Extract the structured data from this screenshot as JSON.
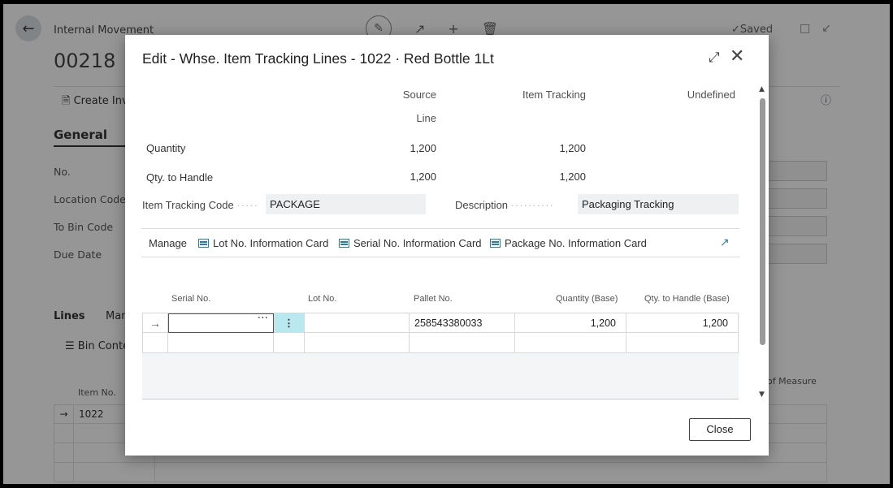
{
  "background": {
    "caption": "Internal Movement",
    "record_no": "00218",
    "saved_label": "Saved",
    "action_create": "Create Inve",
    "section_general": "General",
    "fields": [
      "No.",
      "Location Code",
      "To Bin Code",
      "Due Date"
    ],
    "lines_tab": "Lines",
    "lines_manage": "Man",
    "bin_content": "Bin Conten",
    "col_item_no": "Item No.",
    "col_unit_measure": "of Measure",
    "row_item": "1022"
  },
  "dialog": {
    "title": "Edit - Whse. Item Tracking Lines - 1022 · Red Bottle 1Lt",
    "summary": {
      "headers": [
        "Source",
        "Line",
        "Item Tracking",
        "Undefined"
      ],
      "rows": [
        {
          "label": "Quantity",
          "source": "1,200",
          "tracking": "1,200"
        },
        {
          "label": "Qty. to Handle",
          "source": "1,200",
          "tracking": "1,200"
        }
      ]
    },
    "item_tracking_code_label": "Item Tracking Code",
    "item_tracking_code_value": "PACKAGE",
    "description_label": "Description",
    "description_value": "Packaging Tracking",
    "manage": {
      "label": "Manage",
      "items": [
        "Lot No. Information Card",
        "Serial No. Information Card",
        "Package No. Information Card"
      ]
    },
    "grid": {
      "columns": [
        "Serial No.",
        "Lot No.",
        "Pallet No.",
        "Quantity (Base)",
        "Qty. to Handle (Base)"
      ],
      "rows": [
        {
          "serial": "",
          "lot": "",
          "pallet": "258543380033",
          "qty": "1,200",
          "qty_handle": "1,200"
        }
      ]
    },
    "close_label": "Close"
  }
}
